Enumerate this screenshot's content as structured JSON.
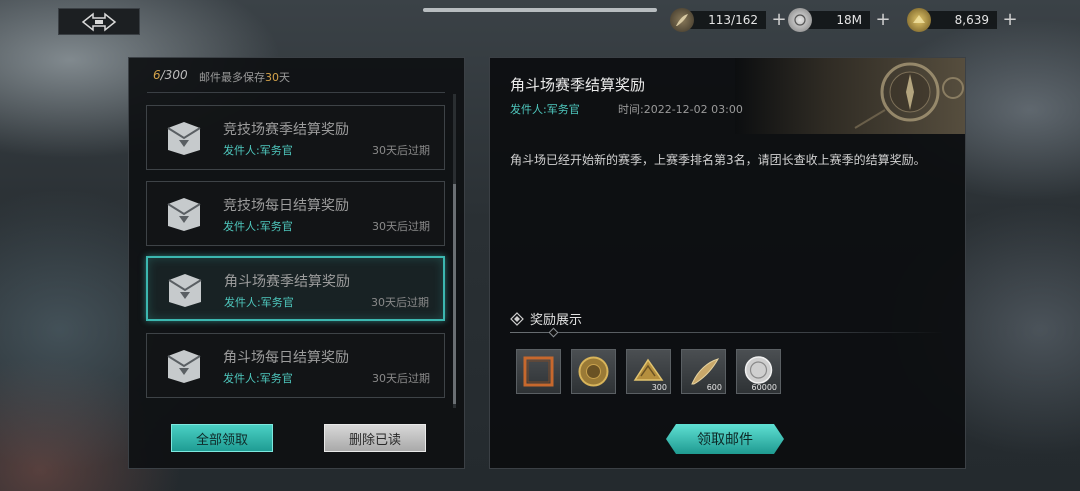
{
  "resources": [
    {
      "icon": "wing-quill-icon",
      "value": "113/162"
    },
    {
      "icon": "silver-coin-icon",
      "value": "18M"
    },
    {
      "icon": "gold-shell-icon",
      "value": "8,639"
    }
  ],
  "mailbox": {
    "count_current": "6",
    "count_total": "/300",
    "note_prefix": "邮件最多保存",
    "note_highlight": "30",
    "note_suffix": "天",
    "items": [
      {
        "title": "竞技场赛季结算奖励",
        "sender": "发件人:军务官",
        "expire": "30天后过期",
        "selected": false
      },
      {
        "title": "竞技场每日结算奖励",
        "sender": "发件人:军务官",
        "expire": "30天后过期",
        "selected": false
      },
      {
        "title": "角斗场赛季结算奖励",
        "sender": "发件人:军务官",
        "expire": "30天后过期",
        "selected": true
      },
      {
        "title": "角斗场每日结算奖励",
        "sender": "发件人:军务官",
        "expire": "30天后过期",
        "selected": false
      }
    ],
    "claim_all_label": "全部领取",
    "delete_read_label": "删除已读"
  },
  "detail": {
    "title": "角斗场赛季结算奖励",
    "sender": "发件人:军务官",
    "time": "时间:2022-12-02 03:00",
    "body": "角斗场已经开始新的赛季，上赛季排名第3名，请团长查收上赛季的结算奖励。",
    "rewards_label": "奖励展示",
    "rewards": [
      {
        "icon": "frame-icon",
        "qty": ""
      },
      {
        "icon": "gold-shield-icon",
        "qty": ""
      },
      {
        "icon": "gold-shell-icon",
        "qty": "300"
      },
      {
        "icon": "wing-quill-icon",
        "qty": "600"
      },
      {
        "icon": "silver-coin-icon",
        "qty": "60000"
      }
    ],
    "claim_label": "领取邮件"
  },
  "colors": {
    "accent": "#3cb7b0",
    "sender": "#4ec7bd",
    "count_highlight": "#d4a24a"
  }
}
